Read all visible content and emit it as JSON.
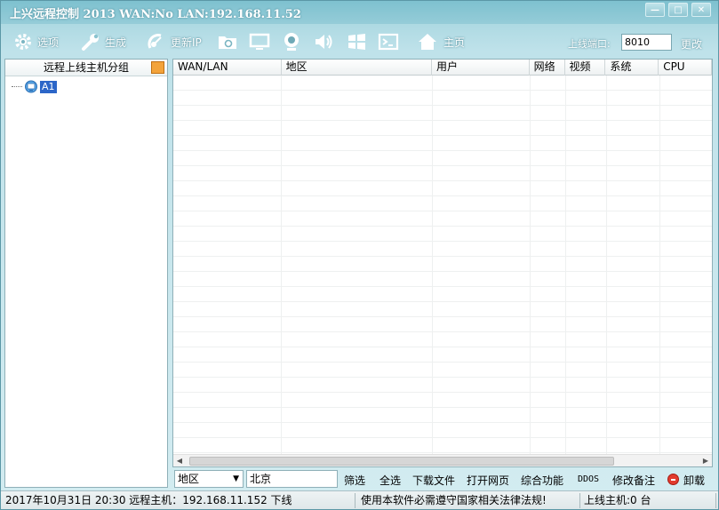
{
  "window": {
    "title": "上兴远程控制 2013 WAN:No LAN:192.168.11.52",
    "controls": [
      "—",
      "□",
      "✕"
    ]
  },
  "toolbar": {
    "items": [
      {
        "label": "选项",
        "icon": "gear-icon"
      },
      {
        "label": "生成",
        "icon": "wrench-icon"
      },
      {
        "label": "更新IP",
        "icon": "satellite-icon"
      },
      {
        "label": "",
        "icon": "folder-icon"
      },
      {
        "label": "",
        "icon": "monitor-icon"
      },
      {
        "label": "",
        "icon": "webcam-icon"
      },
      {
        "label": "",
        "icon": "speaker-icon"
      },
      {
        "label": "",
        "icon": "windows-icon"
      },
      {
        "label": "",
        "icon": "terminal-icon"
      },
      {
        "label": "主页",
        "icon": "home-icon"
      }
    ],
    "port_label": "上线端口:",
    "port_value": "8010",
    "change_label": "更改"
  },
  "left_panel": {
    "title": "远程上线主机分组",
    "tree": [
      {
        "label": "A1",
        "icon": "computer-group-icon"
      }
    ]
  },
  "list": {
    "columns": [
      "WAN/LAN",
      "地区",
      "用户",
      "网络",
      "视频",
      "系统",
      "CPU"
    ],
    "rows": []
  },
  "actions": {
    "filter_field": "地区",
    "filter_value": "北京",
    "buttons": [
      "筛选",
      "全选",
      "下载文件",
      "打开网页",
      "综合功能",
      "DDOS",
      "修改备注",
      "卸载"
    ]
  },
  "status": {
    "datetime_host": "2017年10月31日 20:30 远程主机：192.168.11.152 下线",
    "notice": "使用本软件必需遵守国家相关法律法规!",
    "online_count": "上线主机:0 台"
  },
  "colors": {
    "accent": "#9fd2dc",
    "selection": "#2c66c8",
    "uninstall": "#e23b2e"
  }
}
